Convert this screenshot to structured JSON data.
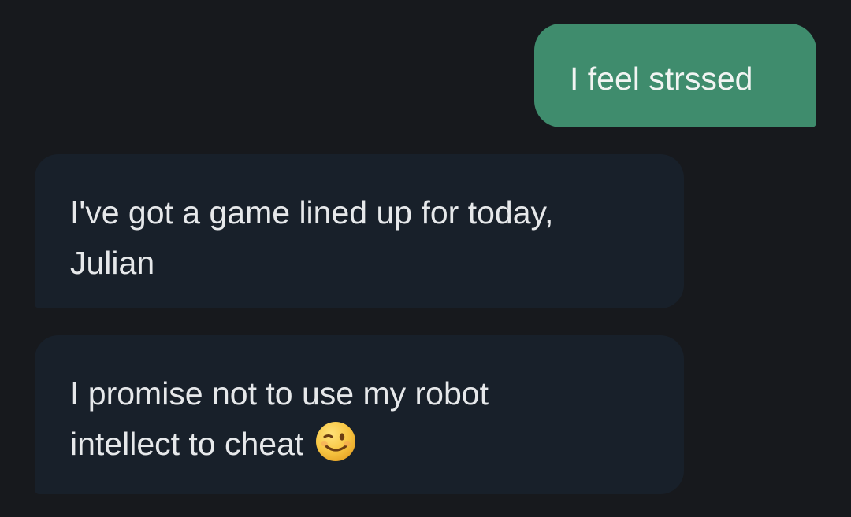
{
  "conversation": {
    "messages": [
      {
        "sender": "user",
        "lines": [
          "I feel strssed"
        ]
      },
      {
        "sender": "bot",
        "lines": [
          "I've got a game lined up for today,",
          "Julian"
        ]
      },
      {
        "sender": "bot",
        "lines": [
          "I promise not to use my robot",
          "intellect to cheat"
        ],
        "emoji": "winking-face-icon"
      }
    ]
  },
  "colors": {
    "background": "#17191d",
    "user_bubble": "#3f8c6d",
    "bot_bubble": "#18202a",
    "text": "#e6e8ea"
  }
}
